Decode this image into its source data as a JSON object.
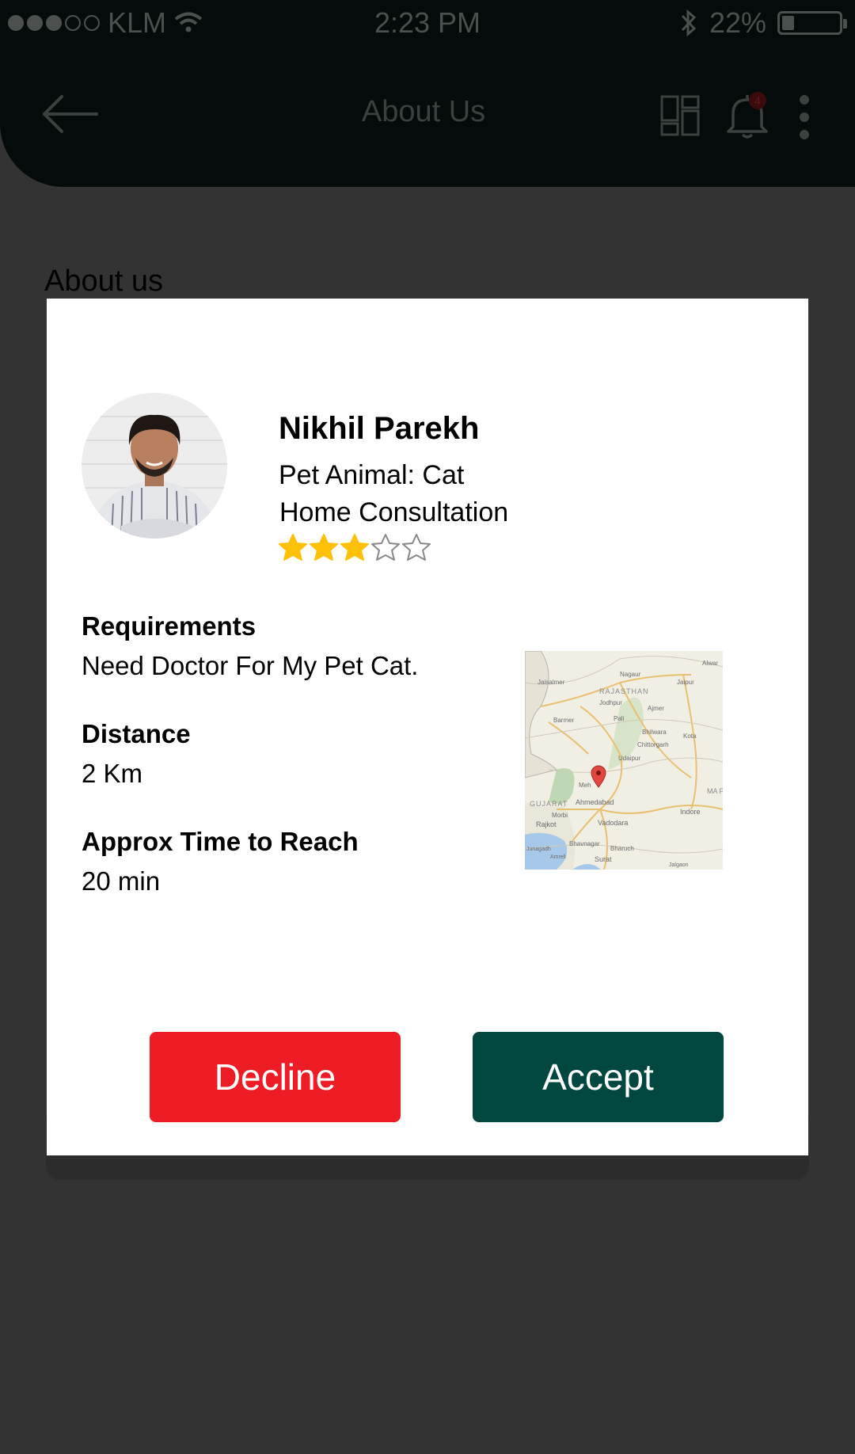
{
  "status_bar": {
    "carrier": "KLM",
    "time": "2:23 PM",
    "battery_text": "22%",
    "battery_level": 0.22,
    "signal_bars_filled": 3,
    "signal_bars_total": 5
  },
  "app_bar": {
    "title": "About Us",
    "notification_count": "4"
  },
  "page": {
    "heading": "About us"
  },
  "modal": {
    "name": "Nikhil Parekh",
    "pet_animal": "Pet Animal: Cat",
    "consultation": "Home Consultation",
    "rating": 3,
    "rating_max": 5,
    "requirements_label": "Requirements",
    "requirements_value": "Need Doctor For My Pet Cat.",
    "distance_label": "Distance",
    "distance_value": "2 Km",
    "time_label": "Approx Time to Reach",
    "time_value": "20 min",
    "map_labels": {
      "nagaur": "Nagaur",
      "alwar": "Alwar",
      "jaisalmer": "Jaisalmer",
      "jaipur": "Jaipur",
      "rajasthan": "RAJASTHAN",
      "jodhpur": "Jodhpur",
      "ajmer": "Ajmer",
      "barmer": "Barmer",
      "pali": "Pali",
      "bhilwara": "Bhilwara",
      "kota": "Kota",
      "chittorgarh": "Chittorgarh",
      "udaipur": "Udaipur",
      "mehsana": "Meh",
      "gujarat": "GUJARAT",
      "ahmedabad": "Ahmedabad",
      "morbi": "Morbi",
      "rajkot": "Rajkot",
      "vadodara": "Vadodara",
      "indore": "Indore",
      "mp": "MA PRA",
      "bhavnagar": "Bhavnagar",
      "junagadh": "Junagadh",
      "amreli": "Amreli",
      "bharuch": "Bharuch",
      "surat": "Surat",
      "jalgaon": "Jalgaon"
    },
    "decline_label": "Decline",
    "accept_label": "Accept"
  },
  "colors": {
    "decline": "#ee1c25",
    "accept": "#00483f",
    "star_filled": "#ffc107",
    "star_empty": "#888888",
    "app_bar": "#040b0a",
    "overlay": "#333333"
  },
  "icons": {
    "back": "arrow-left-icon",
    "grid": "dashboard-grid-icon",
    "bell": "bell-icon",
    "more": "more-vertical-icon",
    "wifi": "wifi-icon",
    "bluetooth": "bluetooth-icon",
    "battery": "battery-icon",
    "map_pin": "map-pin-icon"
  }
}
